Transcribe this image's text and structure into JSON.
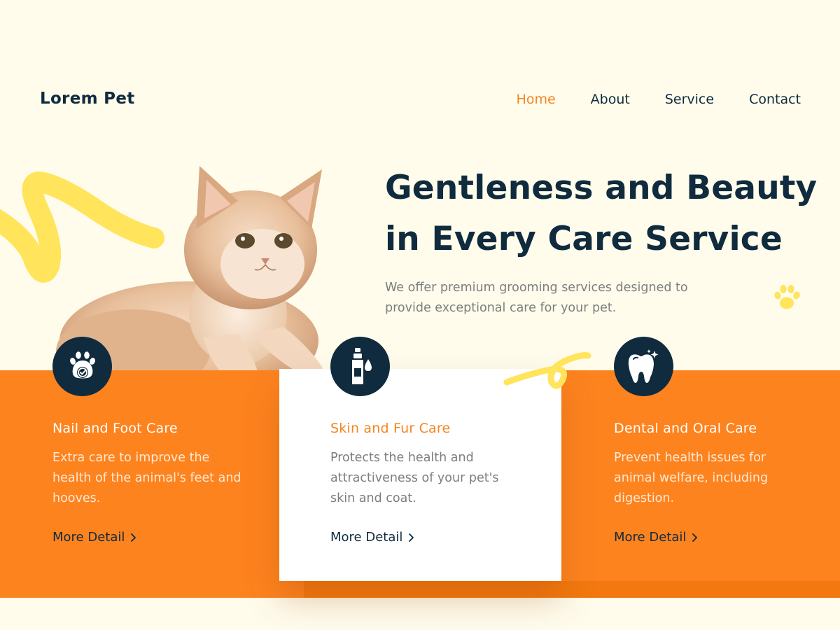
{
  "brand": {
    "logo": "Lorem Pet"
  },
  "nav": {
    "items": [
      "Home",
      "About",
      "Service",
      "Contact"
    ],
    "active": "Home"
  },
  "hero": {
    "title_line1": "Gentleness and Beauty",
    "title_line2": "in Every Care Service",
    "subtitle_line1": "We offer premium grooming services designed to",
    "subtitle_line2": "provide exceptional care for your pet."
  },
  "services": [
    {
      "icon": "paw-check-icon",
      "title": "Nail and Foot Care",
      "description": "Extra care to improve the health of the animal's feet and hooves.",
      "link": "More Detail"
    },
    {
      "icon": "bottle-drop-icon",
      "title": "Skin and Fur Care",
      "description": "Protects the health and attractiveness of your pet's skin and coat.",
      "link": "More Detail"
    },
    {
      "icon": "tooth-sparkle-icon",
      "title": "Dental and Oral Care",
      "description": "Prevent health issues for animal welfare, including digestion.",
      "link": "More Detail"
    }
  ],
  "colors": {
    "background": "#fffcec",
    "accent": "#fd831f",
    "navy": "#0f2b3d",
    "yellow": "#ffe45c",
    "muted_text": "#7d7d7d"
  }
}
